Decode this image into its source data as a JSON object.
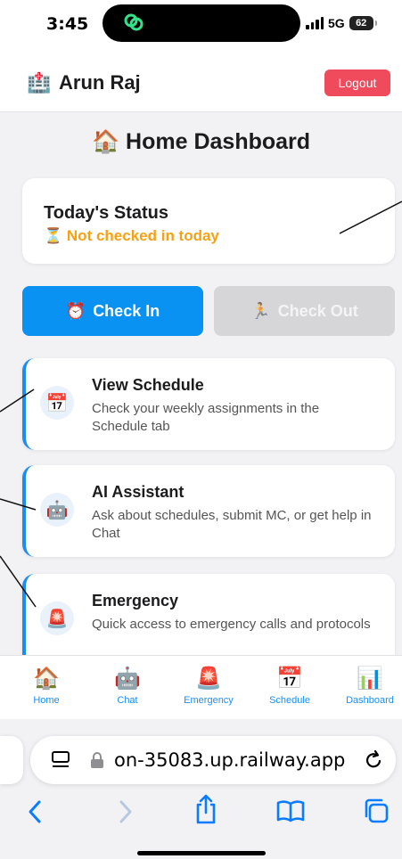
{
  "status_bar": {
    "time": "3:45",
    "network": "5G",
    "battery": "62"
  },
  "header": {
    "user_icon": "hospital-icon",
    "user_name": "Arun Raj",
    "logout_label": "Logout"
  },
  "page": {
    "title_icon": "🏠",
    "title": "Home Dashboard"
  },
  "status_card": {
    "title": "Today's Status",
    "icon": "⏳",
    "message": "Not checked in today",
    "message_color": "#f5a114"
  },
  "actions": {
    "check_in": {
      "icon": "⏰",
      "label": "Check In",
      "color": "#0a92f2"
    },
    "check_out": {
      "icon": "🏃",
      "label": "Check Out",
      "color": "#d6d6d8"
    }
  },
  "features": [
    {
      "icon": "📅",
      "title": "View Schedule",
      "description": "Check your weekly assignments in the Schedule tab"
    },
    {
      "icon": "🤖",
      "title": "AI Assistant",
      "description": "Ask about schedules, submit MC, or get help in Chat"
    },
    {
      "icon": "🚨",
      "title": "Emergency",
      "description": "Quick access to emergency calls and protocols"
    }
  ],
  "nav": [
    {
      "icon": "🏠",
      "label": "Home"
    },
    {
      "icon": "🤖",
      "label": "Chat"
    },
    {
      "icon": "🚨",
      "label": "Emergency"
    },
    {
      "icon": "📅",
      "label": "Schedule"
    },
    {
      "icon": "📊",
      "label": "Dashboard"
    }
  ],
  "browser": {
    "url": "on-35083.up.railway.app",
    "accent": "#1a8ef0"
  }
}
